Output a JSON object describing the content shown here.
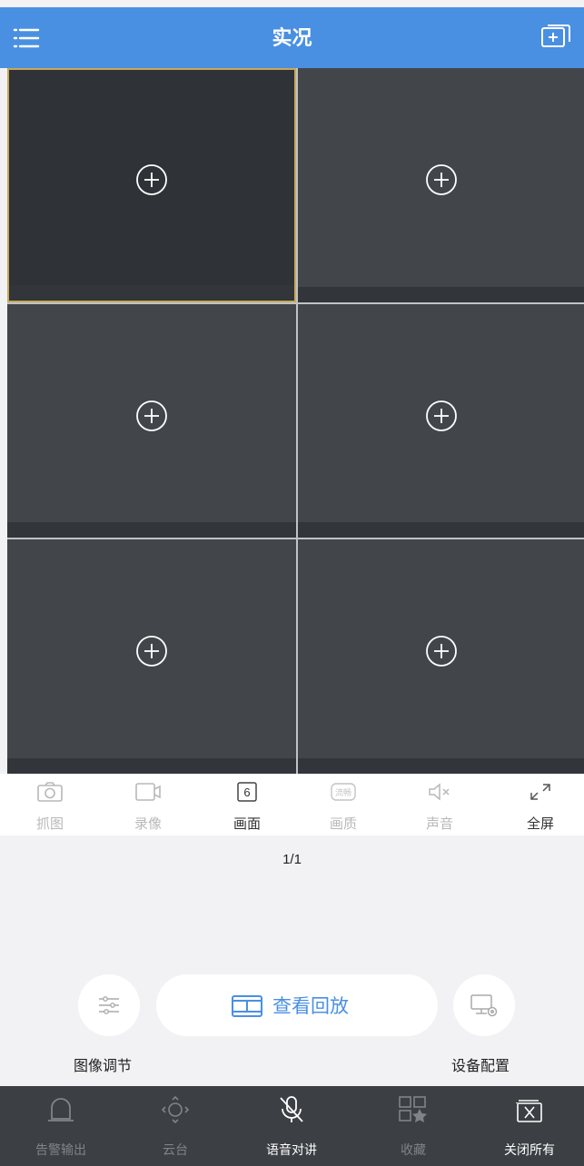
{
  "header": {
    "title": "实况"
  },
  "toolbar": {
    "items": [
      {
        "label": "抓图",
        "icon": "camera-icon",
        "enabled": false
      },
      {
        "label": "录像",
        "icon": "video-record-icon",
        "enabled": false
      },
      {
        "label": "画面",
        "icon": "split-count-icon",
        "badge": "6",
        "enabled": true
      },
      {
        "label": "画质",
        "icon": "quality-icon",
        "badge": "流畅",
        "enabled": false
      },
      {
        "label": "声音",
        "icon": "speaker-mute-icon",
        "enabled": false
      },
      {
        "label": "全屏",
        "icon": "fullscreen-icon",
        "enabled": true
      }
    ]
  },
  "pager": {
    "text": "1/1"
  },
  "actions": {
    "image_adjust": "图像调节",
    "playback": "查看回放",
    "device_config": "设备配置"
  },
  "bottom": {
    "items": [
      {
        "label": "告警输出",
        "icon": "alarm-light-icon",
        "enabled": false
      },
      {
        "label": "云台",
        "icon": "ptz-icon",
        "enabled": false
      },
      {
        "label": "语音对讲",
        "icon": "microphone-off-icon",
        "enabled": true
      },
      {
        "label": "收藏",
        "icon": "favorite-icon",
        "enabled": false
      },
      {
        "label": "关闭所有",
        "icon": "close-all-icon",
        "enabled": true
      }
    ]
  },
  "colors": {
    "accent": "#4a90e2",
    "active_border": "#c8a85a",
    "cell_bg": "#42464b",
    "bottom_bg": "#3c3f43"
  }
}
